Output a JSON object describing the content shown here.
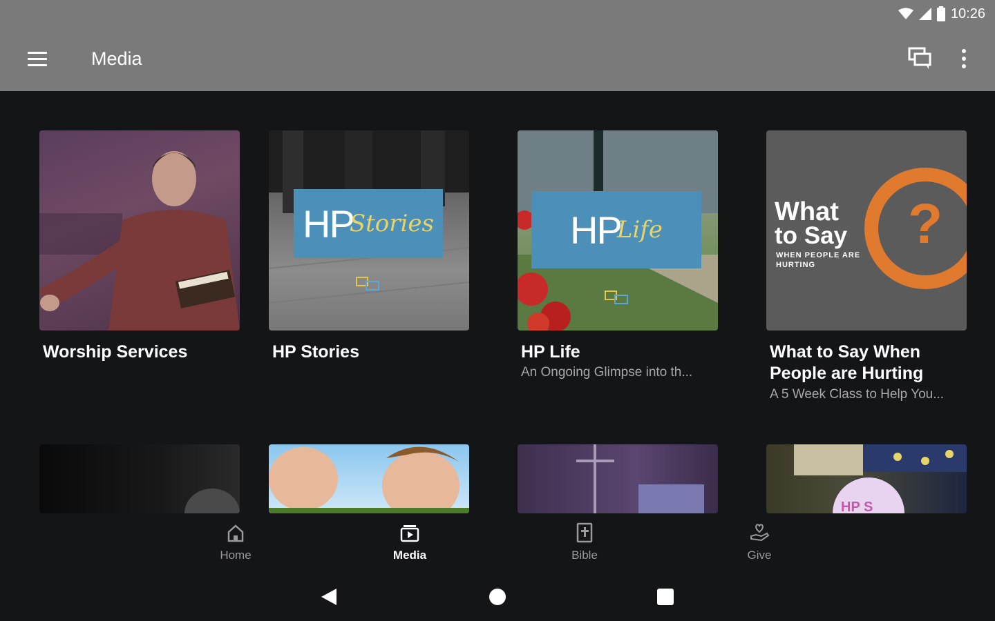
{
  "status_bar": {
    "time": "10:26"
  },
  "app_bar": {
    "title": "Media"
  },
  "cards": [
    {
      "title": "Worship Services",
      "subtitle": ""
    },
    {
      "title": "HP Stories",
      "subtitle": "",
      "thumb_text": "HP",
      "thumb_script": "Stories"
    },
    {
      "title": "HP Life",
      "subtitle": "An Ongoing Glimpse into th...",
      "thumb_text": "HP",
      "thumb_script": "Life"
    },
    {
      "title": "What to Say When People are Hurting",
      "subtitle": "A 5 Week Class to Help You...",
      "thumb_line1": "What",
      "thumb_line2": "to Say",
      "thumb_small": "WHEN PEOPLE ARE HURTING",
      "thumb_mark": "?"
    }
  ],
  "bottom_row_badge": "HP S",
  "bottom_nav": [
    {
      "label": "Home",
      "icon": "home-icon",
      "active": false
    },
    {
      "label": "Media",
      "icon": "media-icon",
      "active": true
    },
    {
      "label": "Bible",
      "icon": "bible-icon",
      "active": false
    },
    {
      "label": "Give",
      "icon": "give-icon",
      "active": false
    }
  ],
  "colors": {
    "app_bar": "#7a7a7a",
    "background": "#141517",
    "accent_blue": "#4c8fb8",
    "accent_orange": "#e07a2e"
  }
}
